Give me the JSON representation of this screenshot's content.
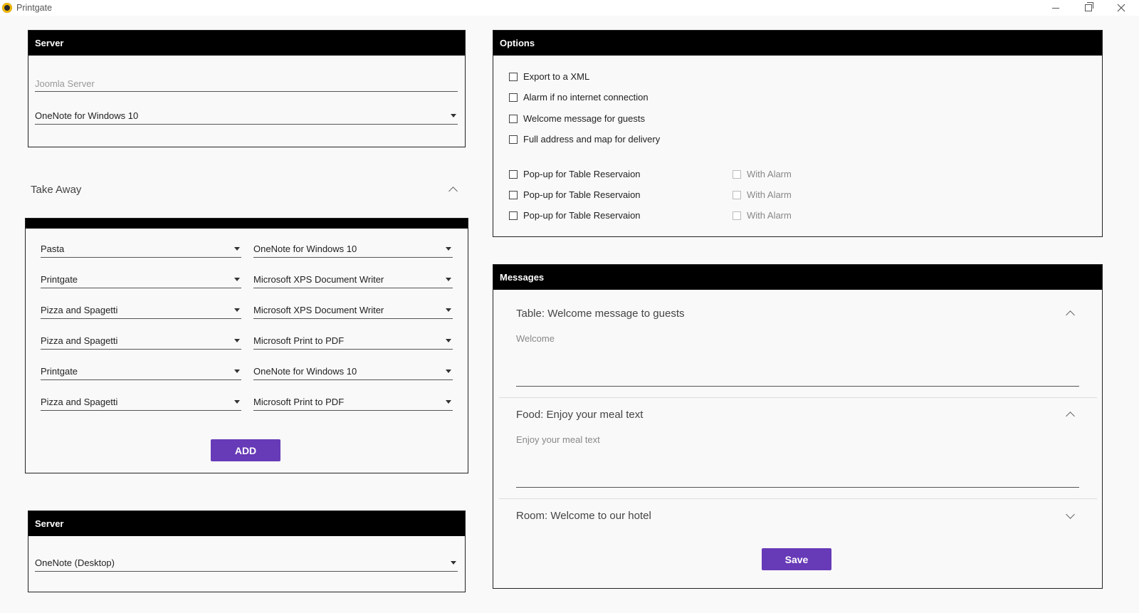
{
  "window": {
    "title": "Printgate"
  },
  "server_top": {
    "header": "Server",
    "joomla_placeholder": "Joomla Server",
    "printer": "OneNote for Windows 10"
  },
  "take_away": {
    "title": "Take Away",
    "rows": [
      {
        "category": "Pasta",
        "printer": "OneNote for Windows 10"
      },
      {
        "category": "Printgate",
        "printer": "Microsoft XPS Document Writer"
      },
      {
        "category": "Pizza and Spagetti",
        "printer": "Microsoft XPS Document Writer"
      },
      {
        "category": "Pizza and Spagetti",
        "printer": "Microsoft Print to PDF"
      },
      {
        "category": "Printgate",
        "printer": "OneNote for Windows 10"
      },
      {
        "category": "Pizza and Spagetti",
        "printer": "Microsoft Print to PDF"
      }
    ],
    "add_label": "ADD"
  },
  "server_bottom": {
    "header": "Server",
    "printer": "OneNote (Desktop)"
  },
  "options": {
    "header": "Options",
    "checks": [
      "Export to a XML",
      "Alarm if no internet connection",
      "Welcome message for guests",
      "Full address and map for delivery"
    ],
    "popups": [
      {
        "label": "Pop-up for Table Reservaion",
        "alarm": "With Alarm"
      },
      {
        "label": "Pop-up for Table Reservaion",
        "alarm": "With Alarm"
      },
      {
        "label": "Pop-up for Table Reservaion",
        "alarm": "With Alarm"
      }
    ]
  },
  "messages": {
    "header": "Messages",
    "table": {
      "title": "Table: Welcome message to guests",
      "placeholder": "Welcome"
    },
    "food": {
      "title": "Food: Enjoy your meal text",
      "placeholder": "Enjoy your meal text"
    },
    "room": {
      "title": "Room: Welcome to our hotel"
    },
    "save_label": "Save"
  },
  "colors": {
    "accent": "#673ab7",
    "header_bg": "#000000"
  }
}
